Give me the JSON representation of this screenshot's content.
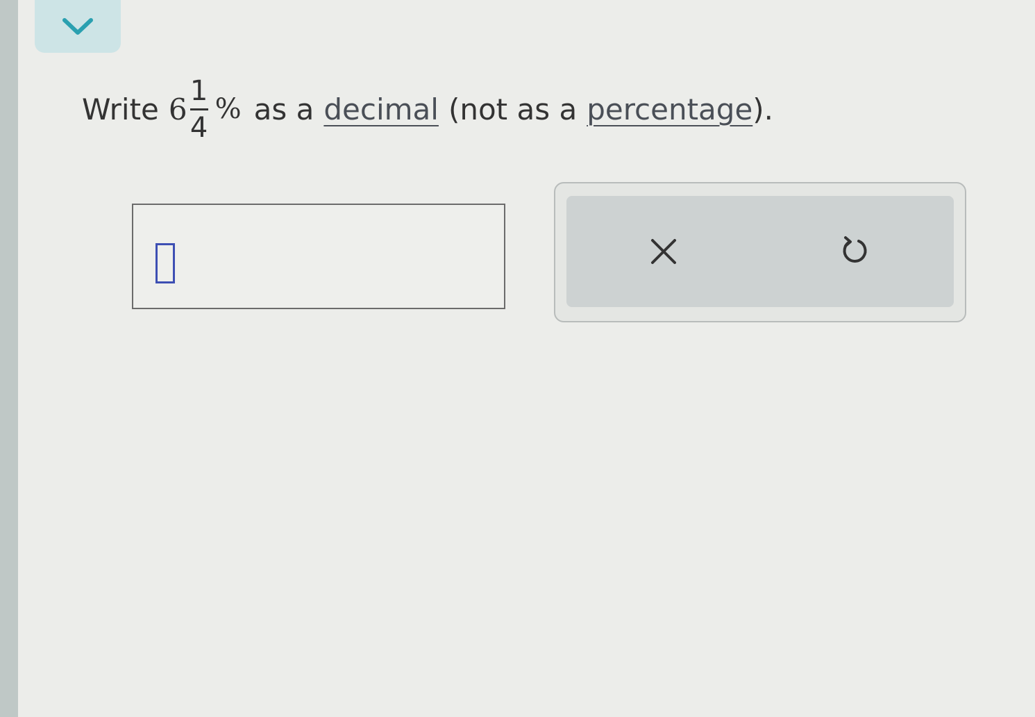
{
  "question": {
    "prefix": "Write",
    "mixed_number": {
      "whole": "6",
      "numerator": "1",
      "denominator": "4"
    },
    "percent_sign": "%",
    "text_as_a": "as a",
    "link_decimal": "decimal",
    "text_middle": "(not as a",
    "link_percentage": "percentage",
    "text_end": ")."
  },
  "answer_input": {
    "value": ""
  },
  "actions": {
    "clear_icon": "close-icon",
    "undo_icon": "undo-icon"
  },
  "colors": {
    "accent": "#2aa0b0",
    "toggle_bg": "#cde4e6",
    "caret": "#3d4fb3"
  }
}
